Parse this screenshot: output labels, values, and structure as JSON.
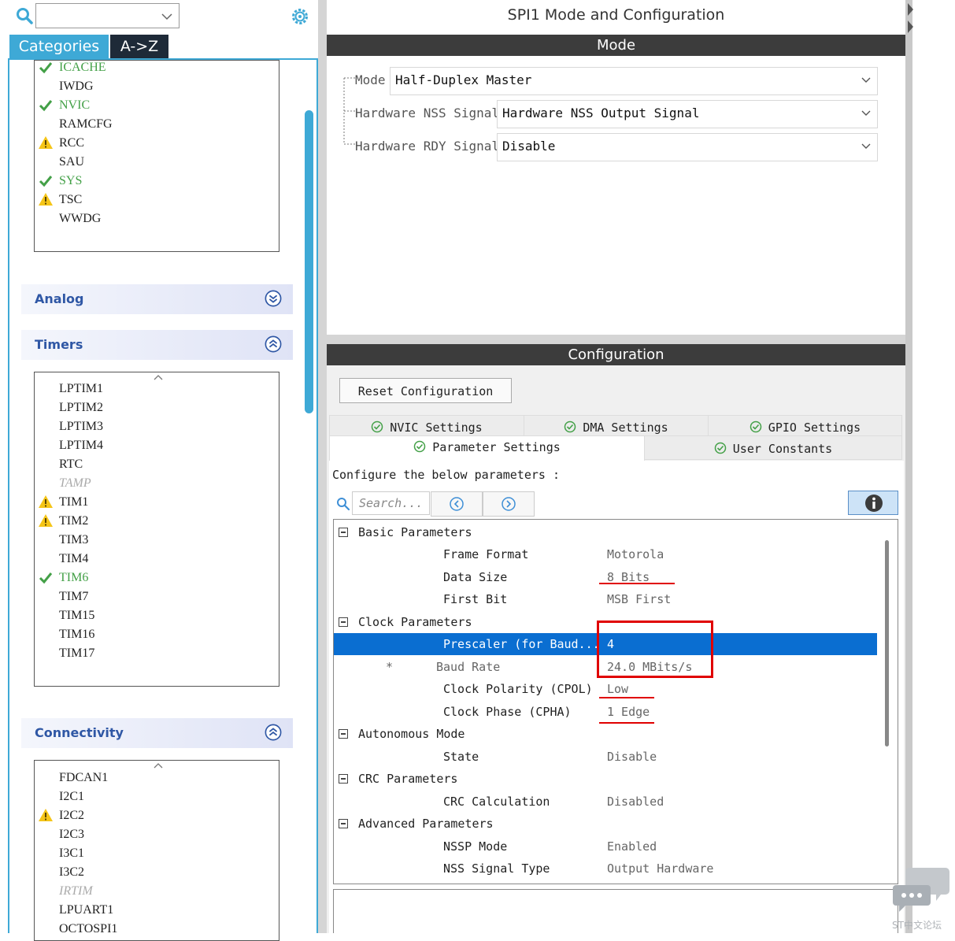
{
  "left": {
    "search_placeholder": "",
    "tabs": {
      "categories": "Categories",
      "az": "A->Z"
    },
    "system_items": [
      {
        "label": "ICACHE",
        "status": "ok"
      },
      {
        "label": "IWDG",
        "status": "none"
      },
      {
        "label": "NVIC",
        "status": "ok"
      },
      {
        "label": "RAMCFG",
        "status": "none"
      },
      {
        "label": "RCC",
        "status": "warn"
      },
      {
        "label": "SAU",
        "status": "none"
      },
      {
        "label": "SYS",
        "status": "ok"
      },
      {
        "label": "TSC",
        "status": "warn"
      },
      {
        "label": "WWDG",
        "status": "none"
      }
    ],
    "sections": {
      "analog": "Analog",
      "timers": "Timers",
      "connectivity": "Connectivity"
    },
    "timer_items": [
      {
        "label": "LPTIM1",
        "status": "none"
      },
      {
        "label": "LPTIM2",
        "status": "none"
      },
      {
        "label": "LPTIM3",
        "status": "none"
      },
      {
        "label": "LPTIM4",
        "status": "none"
      },
      {
        "label": "RTC",
        "status": "none"
      },
      {
        "label": "TAMP",
        "status": "disabled"
      },
      {
        "label": "TIM1",
        "status": "warn"
      },
      {
        "label": "TIM2",
        "status": "warn"
      },
      {
        "label": "TIM3",
        "status": "none"
      },
      {
        "label": "TIM4",
        "status": "none"
      },
      {
        "label": "TIM6",
        "status": "ok"
      },
      {
        "label": "TIM7",
        "status": "none"
      },
      {
        "label": "TIM15",
        "status": "none"
      },
      {
        "label": "TIM16",
        "status": "none"
      },
      {
        "label": "TIM17",
        "status": "none"
      }
    ],
    "connectivity_items": [
      {
        "label": "FDCAN1",
        "status": "none"
      },
      {
        "label": "I2C1",
        "status": "none"
      },
      {
        "label": "I2C2",
        "status": "warn"
      },
      {
        "label": "I2C3",
        "status": "none"
      },
      {
        "label": "I3C1",
        "status": "none"
      },
      {
        "label": "I3C2",
        "status": "none"
      },
      {
        "label": "IRTIM",
        "status": "disabled"
      },
      {
        "label": "LPUART1",
        "status": "none"
      },
      {
        "label": "OCTOSPI1",
        "status": "none"
      }
    ]
  },
  "right": {
    "title": "SPI1 Mode and Configuration",
    "mode_bar": "Mode",
    "mode_fields": [
      {
        "label": "Mode",
        "value": "Half-Duplex Master"
      },
      {
        "label": "Hardware NSS Signal",
        "value": "Hardware NSS Output Signal"
      },
      {
        "label": "Hardware RDY Signal",
        "value": "Disable"
      }
    ],
    "config_bar": "Configuration",
    "reset_button": "Reset Configuration",
    "tabs": {
      "nvic": "NVIC Settings",
      "dma": "DMA Settings",
      "gpio": "GPIO Settings",
      "params": "Parameter Settings",
      "user": "User Constants"
    },
    "config_text": "Configure the below parameters :",
    "search_placeholder": "Search...",
    "groups": {
      "basic": "Basic Parameters",
      "clock": "Clock Parameters",
      "auto": "Autonomous Mode",
      "crc": "CRC Parameters",
      "adv": "Advanced Parameters"
    },
    "params": {
      "frame_format": {
        "name": "Frame Format",
        "value": "Motorola"
      },
      "data_size": {
        "name": "Data Size",
        "value": "8 Bits"
      },
      "first_bit": {
        "name": "First Bit",
        "value": "MSB First"
      },
      "prescaler": {
        "name": "Prescaler (for Baud...",
        "value": "4"
      },
      "baud_rate": {
        "marker": "*",
        "name": "Baud Rate",
        "value": "24.0 MBits/s"
      },
      "cpol": {
        "name": "Clock Polarity (CPOL)",
        "value": "Low"
      },
      "cpha": {
        "name": "Clock Phase (CPHA)",
        "value": "1 Edge"
      },
      "state": {
        "name": "State",
        "value": "Disable"
      },
      "crc_calc": {
        "name": "CRC Calculation",
        "value": "Disabled"
      },
      "nssp": {
        "name": "NSSP Mode",
        "value": "Enabled"
      },
      "nss_type": {
        "name": "NSS Signal Type",
        "value": "Output Hardware"
      }
    }
  },
  "watermark": "ST中文论坛",
  "colors": {
    "accent": "#3ea9d6",
    "selection": "#0a6ed1",
    "annotation": "#e00000",
    "ok": "#43a047",
    "warn": "#f5c518"
  }
}
